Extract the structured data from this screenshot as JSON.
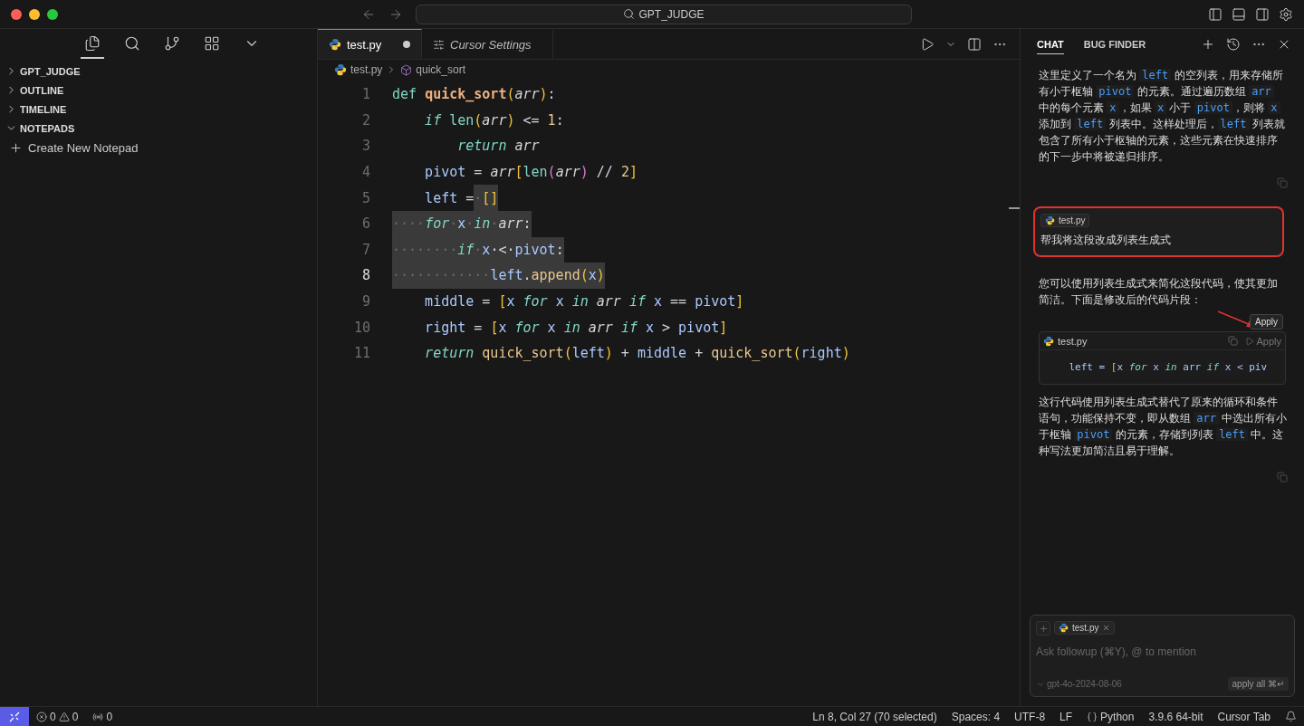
{
  "titlebar": {
    "search": "GPT_JUDGE"
  },
  "sidebar": {
    "sections": [
      {
        "label": "GPT_JUDGE",
        "expanded": false
      },
      {
        "label": "OUTLINE",
        "expanded": false
      },
      {
        "label": "TIMELINE",
        "expanded": false
      },
      {
        "label": "NOTEPADS",
        "expanded": true
      }
    ],
    "action": "Create New Notepad"
  },
  "editor": {
    "tabs": [
      {
        "label": "test.py",
        "kind": "file",
        "selected": true,
        "modified": true
      },
      {
        "label": "Cursor Settings",
        "kind": "settings",
        "selected": false,
        "modified": false
      }
    ],
    "breadcrumb": {
      "file": "test.py",
      "symbol": "quick_sort"
    },
    "lines": [
      {
        "number": "1",
        "current": false,
        "tokens": [
          {
            "text": "def ",
            "kind": "kw"
          },
          {
            "text": "quick_sort",
            "kind": "fn"
          },
          {
            "text": "(",
            "kind": "br"
          },
          {
            "text": "arr",
            "kind": "param"
          },
          {
            "text": ")",
            "kind": "br"
          },
          {
            "text": ":",
            "kind": "p"
          }
        ]
      },
      {
        "number": "2",
        "current": false,
        "tokens": [
          {
            "text": "    if ",
            "kind": "ctl"
          },
          {
            "text": "len",
            "kind": "bi"
          },
          {
            "text": "(",
            "kind": "br"
          },
          {
            "text": "arr",
            "kind": "param"
          },
          {
            "text": ")",
            "kind": "br"
          },
          {
            "text": " <= ",
            "kind": "p"
          },
          {
            "text": "1",
            "kind": "num"
          },
          {
            "text": ":",
            "kind": "p"
          }
        ]
      },
      {
        "number": "3",
        "current": false,
        "tokens": [
          {
            "text": "        return ",
            "kind": "ctl"
          },
          {
            "text": "arr",
            "kind": "param"
          }
        ]
      },
      {
        "number": "4",
        "current": false,
        "tokens": [
          {
            "text": "    pivot",
            "kind": "var"
          },
          {
            "text": " = ",
            "kind": "p"
          },
          {
            "text": "arr",
            "kind": "param"
          },
          {
            "text": "[",
            "kind": "br"
          },
          {
            "text": "len",
            "kind": "bi"
          },
          {
            "text": "(",
            "kind": "br2"
          },
          {
            "text": "arr",
            "kind": "param"
          },
          {
            "text": ")",
            "kind": "br2"
          },
          {
            "text": " // ",
            "kind": "p"
          },
          {
            "text": "2",
            "kind": "num"
          },
          {
            "text": "]",
            "kind": "br"
          }
        ]
      },
      {
        "number": "5",
        "current": false,
        "tokens": [
          {
            "text": "    left",
            "kind": "var"
          },
          {
            "text": " =",
            "kind": "p"
          }
        ],
        "selected": [
          {
            "text": "·",
            "kind": "ws"
          },
          {
            "text": "[]",
            "kind": "br"
          }
        ]
      },
      {
        "number": "6",
        "current": false,
        "selected": [
          {
            "text": "····",
            "kind": "ws"
          },
          {
            "text": "for",
            "kind": "ctl"
          },
          {
            "text": "·",
            "kind": "ws"
          },
          {
            "text": "x",
            "kind": "var"
          },
          {
            "text": "·",
            "kind": "ws"
          },
          {
            "text": "in",
            "kind": "ctl"
          },
          {
            "text": "·",
            "kind": "ws"
          },
          {
            "text": "arr",
            "kind": "param"
          },
          {
            "text": ":",
            "kind": "p"
          }
        ]
      },
      {
        "number": "7",
        "current": false,
        "selected": [
          {
            "text": "········",
            "kind": "ws"
          },
          {
            "text": "if",
            "kind": "ctl"
          },
          {
            "text": "·",
            "kind": "ws"
          },
          {
            "text": "x",
            "kind": "var"
          },
          {
            "text": "·<·",
            "kind": "p"
          },
          {
            "text": "pivot",
            "kind": "var"
          },
          {
            "text": ":",
            "kind": "p"
          }
        ]
      },
      {
        "number": "8",
        "current": true,
        "selected": [
          {
            "text": "············",
            "kind": "ws"
          },
          {
            "text": "left",
            "kind": "var"
          },
          {
            "text": ".",
            "kind": "p"
          },
          {
            "text": "append",
            "kind": "fnc"
          },
          {
            "text": "(",
            "kind": "br"
          },
          {
            "text": "x",
            "kind": "var"
          },
          {
            "text": ")",
            "kind": "br"
          }
        ]
      },
      {
        "number": "9",
        "current": false,
        "tokens": [
          {
            "text": "    middle",
            "kind": "var"
          },
          {
            "text": " = ",
            "kind": "p"
          },
          {
            "text": "[",
            "kind": "br"
          },
          {
            "text": "x ",
            "kind": "var"
          },
          {
            "text": "for ",
            "kind": "ctl"
          },
          {
            "text": "x ",
            "kind": "var"
          },
          {
            "text": "in ",
            "kind": "ctl"
          },
          {
            "text": "arr ",
            "kind": "param"
          },
          {
            "text": "if ",
            "kind": "ctl"
          },
          {
            "text": "x",
            "kind": "var"
          },
          {
            "text": " == ",
            "kind": "p"
          },
          {
            "text": "pivot",
            "kind": "var"
          },
          {
            "text": "]",
            "kind": "br"
          }
        ]
      },
      {
        "number": "10",
        "current": false,
        "tokens": [
          {
            "text": "    right",
            "kind": "var"
          },
          {
            "text": " = ",
            "kind": "p"
          },
          {
            "text": "[",
            "kind": "br"
          },
          {
            "text": "x ",
            "kind": "var"
          },
          {
            "text": "for ",
            "kind": "ctl"
          },
          {
            "text": "x ",
            "kind": "var"
          },
          {
            "text": "in ",
            "kind": "ctl"
          },
          {
            "text": "arr ",
            "kind": "param"
          },
          {
            "text": "if ",
            "kind": "ctl"
          },
          {
            "text": "x",
            "kind": "var"
          },
          {
            "text": " > ",
            "kind": "p"
          },
          {
            "text": "pivot",
            "kind": "var"
          },
          {
            "text": "]",
            "kind": "br"
          }
        ]
      },
      {
        "number": "11",
        "current": false,
        "tokens": [
          {
            "text": "    return ",
            "kind": "ctl"
          },
          {
            "text": "quick_sort",
            "kind": "fnc"
          },
          {
            "text": "(",
            "kind": "br"
          },
          {
            "text": "left",
            "kind": "var"
          },
          {
            "text": ")",
            "kind": "br"
          },
          {
            "text": " + ",
            "kind": "p"
          },
          {
            "text": "middle",
            "kind": "var"
          },
          {
            "text": " + ",
            "kind": "p"
          },
          {
            "text": "quick_sort",
            "kind": "fnc"
          },
          {
            "text": "(",
            "kind": "br"
          },
          {
            "text": "right",
            "kind": "var"
          },
          {
            "text": ")",
            "kind": "br"
          }
        ]
      }
    ]
  },
  "chat": {
    "tabs": [
      {
        "label": "CHAT",
        "selected": true
      },
      {
        "label": "BUG FINDER",
        "selected": false
      }
    ],
    "messages": [
      {
        "kind": "assistant",
        "segments": [
          {
            "text": "这里定义了一个名为 ",
            "kind": "text"
          },
          {
            "text": "left",
            "kind": "code"
          },
          {
            "text": " 的空列表，用来存储所有小于枢轴 ",
            "kind": "text"
          },
          {
            "text": "pivot",
            "kind": "code"
          },
          {
            "text": " 的元素。通过遍历数组 ",
            "kind": "text"
          },
          {
            "text": "arr",
            "kind": "code"
          },
          {
            "text": " 中的每个元素 ",
            "kind": "text"
          },
          {
            "text": "x",
            "kind": "code"
          },
          {
            "text": "，如果 ",
            "kind": "text"
          },
          {
            "text": "x",
            "kind": "code"
          },
          {
            "text": " 小于 ",
            "kind": "text"
          },
          {
            "text": "pivot",
            "kind": "code"
          },
          {
            "text": "，则将 ",
            "kind": "text"
          },
          {
            "text": "x",
            "kind": "code"
          },
          {
            "text": " 添加到 ",
            "kind": "text"
          },
          {
            "text": "left",
            "kind": "code"
          },
          {
            "text": " 列表中。这样处理后，",
            "kind": "text"
          },
          {
            "text": "left",
            "kind": "code"
          },
          {
            "text": " 列表就包含了所有小于枢轴的元素，这些元素在快速排序的下一步中将被递归排序。",
            "kind": "text"
          }
        ]
      },
      {
        "kind": "user",
        "highlighted": true,
        "file": "test.py",
        "text": "帮我将这段改成列表生成式"
      },
      {
        "kind": "assistant",
        "segments": [
          {
            "text": "您可以使用列表生成式来简化这段代码，使其更加简洁。下面是修改后的代码片段：",
            "kind": "text"
          }
        ]
      },
      {
        "kind": "code",
        "file": "test.py",
        "tooltip": "Apply",
        "apply": "Apply",
        "tokens": [
          {
            "text": "    left = ",
            "kind": "var"
          },
          {
            "text": "[",
            "kind": "br"
          },
          {
            "text": "x ",
            "kind": "var"
          },
          {
            "text": "for ",
            "kind": "ctl"
          },
          {
            "text": "x ",
            "kind": "var"
          },
          {
            "text": "in ",
            "kind": "ctl"
          },
          {
            "text": "arr ",
            "kind": "var"
          },
          {
            "text": "if ",
            "kind": "ctl"
          },
          {
            "text": "x < piv",
            "kind": "var"
          }
        ]
      },
      {
        "kind": "assistant",
        "segments": [
          {
            "text": "这行代码使用列表生成式替代了原来的循环和条件语句，功能保持不变，即从数组 ",
            "kind": "text"
          },
          {
            "text": "arr",
            "kind": "code"
          },
          {
            "text": " 中选出所有小于枢轴 ",
            "kind": "text"
          },
          {
            "text": "pivot",
            "kind": "code"
          },
          {
            "text": " 的元素，存储到列表 ",
            "kind": "text"
          },
          {
            "text": "left",
            "kind": "code"
          },
          {
            "text": " 中。这种写法更加简洁且易于理解。",
            "kind": "text"
          }
        ]
      }
    ],
    "input": {
      "chip": "test.py",
      "placeholder": "Ask followup (⌘Y), @ to mention",
      "model": "gpt-4o-2024-08-06",
      "apply_all": "apply all ⌘↵"
    }
  },
  "status_bar": {
    "errors": "0",
    "warnings": "0",
    "ports": "0",
    "items": [
      {
        "kind": "text",
        "label": "Ln 8, Col 27 (70 selected)"
      },
      {
        "kind": "text",
        "label": "Spaces: 4"
      },
      {
        "kind": "text",
        "label": "UTF-8"
      },
      {
        "kind": "text",
        "label": "LF"
      },
      {
        "kind": "language",
        "label": "Python"
      },
      {
        "kind": "text",
        "label": "3.9.6 64-bit"
      },
      {
        "kind": "text",
        "label": "Cursor Tab"
      },
      {
        "kind": "bell"
      }
    ]
  }
}
